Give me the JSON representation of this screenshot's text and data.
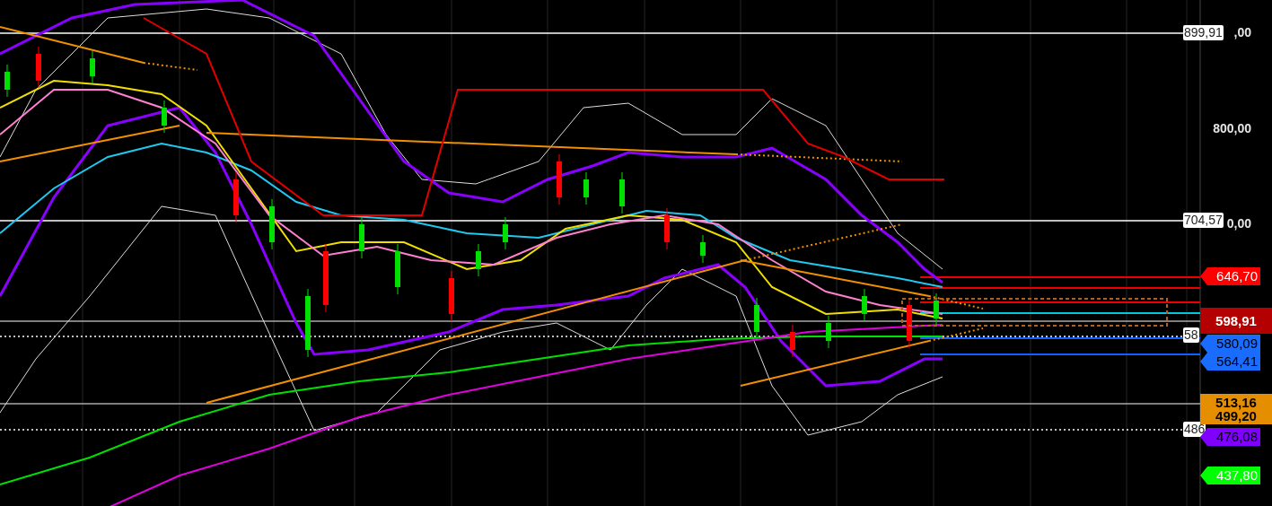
{
  "price_axis": {
    "ticks": [
      {
        "text": ",00"
      },
      {
        "text": "800,00"
      },
      {
        "text": "0,00"
      }
    ]
  },
  "level_labels": [
    {
      "text": "899,91"
    },
    {
      "text": "704,57"
    },
    {
      "text": "58"
    },
    {
      "text": "486"
    }
  ],
  "price_tags": [
    {
      "kind": "arrow",
      "texts": [
        "646,70"
      ],
      "color": "#ff0000"
    },
    {
      "kind": "rect",
      "texts": [
        "598,91"
      ],
      "color": "#b40000"
    },
    {
      "kind": "arrow",
      "texts": [
        "580,09"
      ],
      "color": "#1a6cff"
    },
    {
      "kind": "arrow",
      "texts": [
        "564,41"
      ],
      "color": "#1a6cff"
    },
    {
      "kind": "rect",
      "texts": [
        "513,16",
        "499,20"
      ],
      "color": "#e58e00"
    },
    {
      "kind": "arrow",
      "texts": [
        "476,08"
      ],
      "color": "#8000ff"
    },
    {
      "kind": "arrow",
      "texts": [
        "437,80"
      ],
      "color": "#00ff00"
    }
  ]
}
